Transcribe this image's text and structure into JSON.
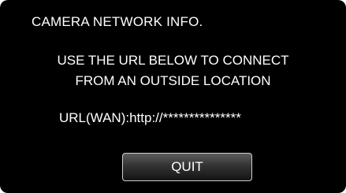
{
  "screen": {
    "title": "CAMERA NETWORK INFO.",
    "message_line1": "USE THE URL BELOW TO CONNECT",
    "message_line2": "FROM AN OUTSIDE LOCATION",
    "url_text": "URL(WAN):http://***************"
  },
  "actions": {
    "quit_label": "QUIT"
  },
  "colors": {
    "background": "#000000",
    "text": "#ffffff",
    "button_border": "#cfcfcf"
  }
}
